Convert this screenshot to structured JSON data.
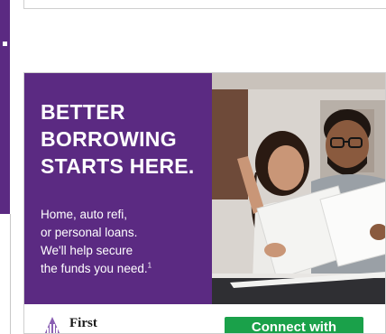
{
  "ad": {
    "headline": [
      "BETTER",
      "BORROWING",
      "STARTS HERE."
    ],
    "body": [
      "Home, auto refi,",
      "or personal loans.",
      "We'll help secure",
      "the funds you need."
    ],
    "footnote": "1",
    "brand": "First",
    "cta_label": "Connect with"
  },
  "colors": {
    "brand_purple": "#5b2a82",
    "cta_green": "#1aa14a"
  }
}
